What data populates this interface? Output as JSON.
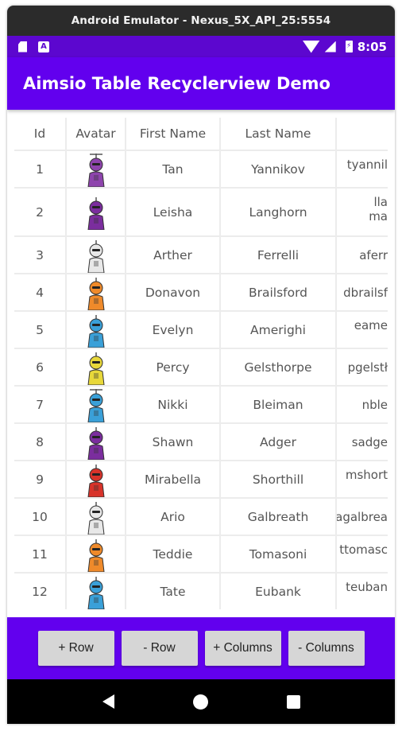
{
  "window": {
    "title": "Android Emulator - Nexus_5X_API_25:5554"
  },
  "status_bar": {
    "time": "8:05",
    "icons": [
      "sd-card-icon",
      "a-notification-icon",
      "wifi-icon",
      "signal-icon",
      "battery-charging-icon"
    ]
  },
  "app_bar": {
    "title": "Aimsio Table Recyclerview Demo"
  },
  "colors": {
    "primary": "#6200ee",
    "status_bar": "#5c07cf",
    "button": "#d6d6d6",
    "grid": "#ececec"
  },
  "table": {
    "columns": [
      "Id",
      "Avatar",
      "First Name",
      "Last Name",
      ""
    ],
    "rows": [
      {
        "id": "1",
        "first": "Tan",
        "last": "Yannikov",
        "email": "tyannil",
        "avatar": "propeller-bot",
        "color": "#8e44ad"
      },
      {
        "id": "2",
        "first": "Leisha",
        "last": "Langhorn",
        "email": "lla\nma",
        "avatar": "dome-bot",
        "color": "#7b2d9e"
      },
      {
        "id": "3",
        "first": "Arther",
        "last": "Ferrelli",
        "email": "aferr",
        "avatar": "white-bot",
        "color": "#e8e8e8"
      },
      {
        "id": "4",
        "first": "Donavon",
        "last": "Brailsford",
        "email": "dbrailsf",
        "avatar": "box-bot",
        "color": "#ef8a2a"
      },
      {
        "id": "5",
        "first": "Evelyn",
        "last": "Amerighi",
        "email": "eame",
        "avatar": "round-bot",
        "color": "#3aa0d8"
      },
      {
        "id": "6",
        "first": "Percy",
        "last": "Gelsthorpe",
        "email": "pgelstł",
        "avatar": "yellow-bot",
        "color": "#e8d83a"
      },
      {
        "id": "7",
        "first": "Nikki",
        "last": "Bleiman",
        "email": "nble",
        "avatar": "propeller-bot",
        "color": "#3aa0d8"
      },
      {
        "id": "8",
        "first": "Shawn",
        "last": "Adger",
        "email": "sadge",
        "avatar": "dome-bot",
        "color": "#7b2d9e"
      },
      {
        "id": "9",
        "first": "Mirabella",
        "last": "Shorthill",
        "email": "mshort",
        "avatar": "red-bot",
        "color": "#d8332a"
      },
      {
        "id": "10",
        "first": "Ario",
        "last": "Galbreath",
        "email": "agalbrea",
        "avatar": "white-bot",
        "color": "#e8e8e8"
      },
      {
        "id": "11",
        "first": "Teddie",
        "last": "Tomasoni",
        "email": "ttomasc",
        "avatar": "box-bot",
        "color": "#ef8a2a"
      },
      {
        "id": "12",
        "first": "Tate",
        "last": "Eubank",
        "email": "teuban",
        "avatar": "round-bot",
        "color": "#3aa0d8"
      }
    ]
  },
  "buttons": {
    "add_row": "+ Row",
    "remove_row": "- Row",
    "add_columns": "+ Columns",
    "remove_columns": "- Columns"
  },
  "nav": [
    "back-icon",
    "home-icon",
    "recents-icon"
  ]
}
